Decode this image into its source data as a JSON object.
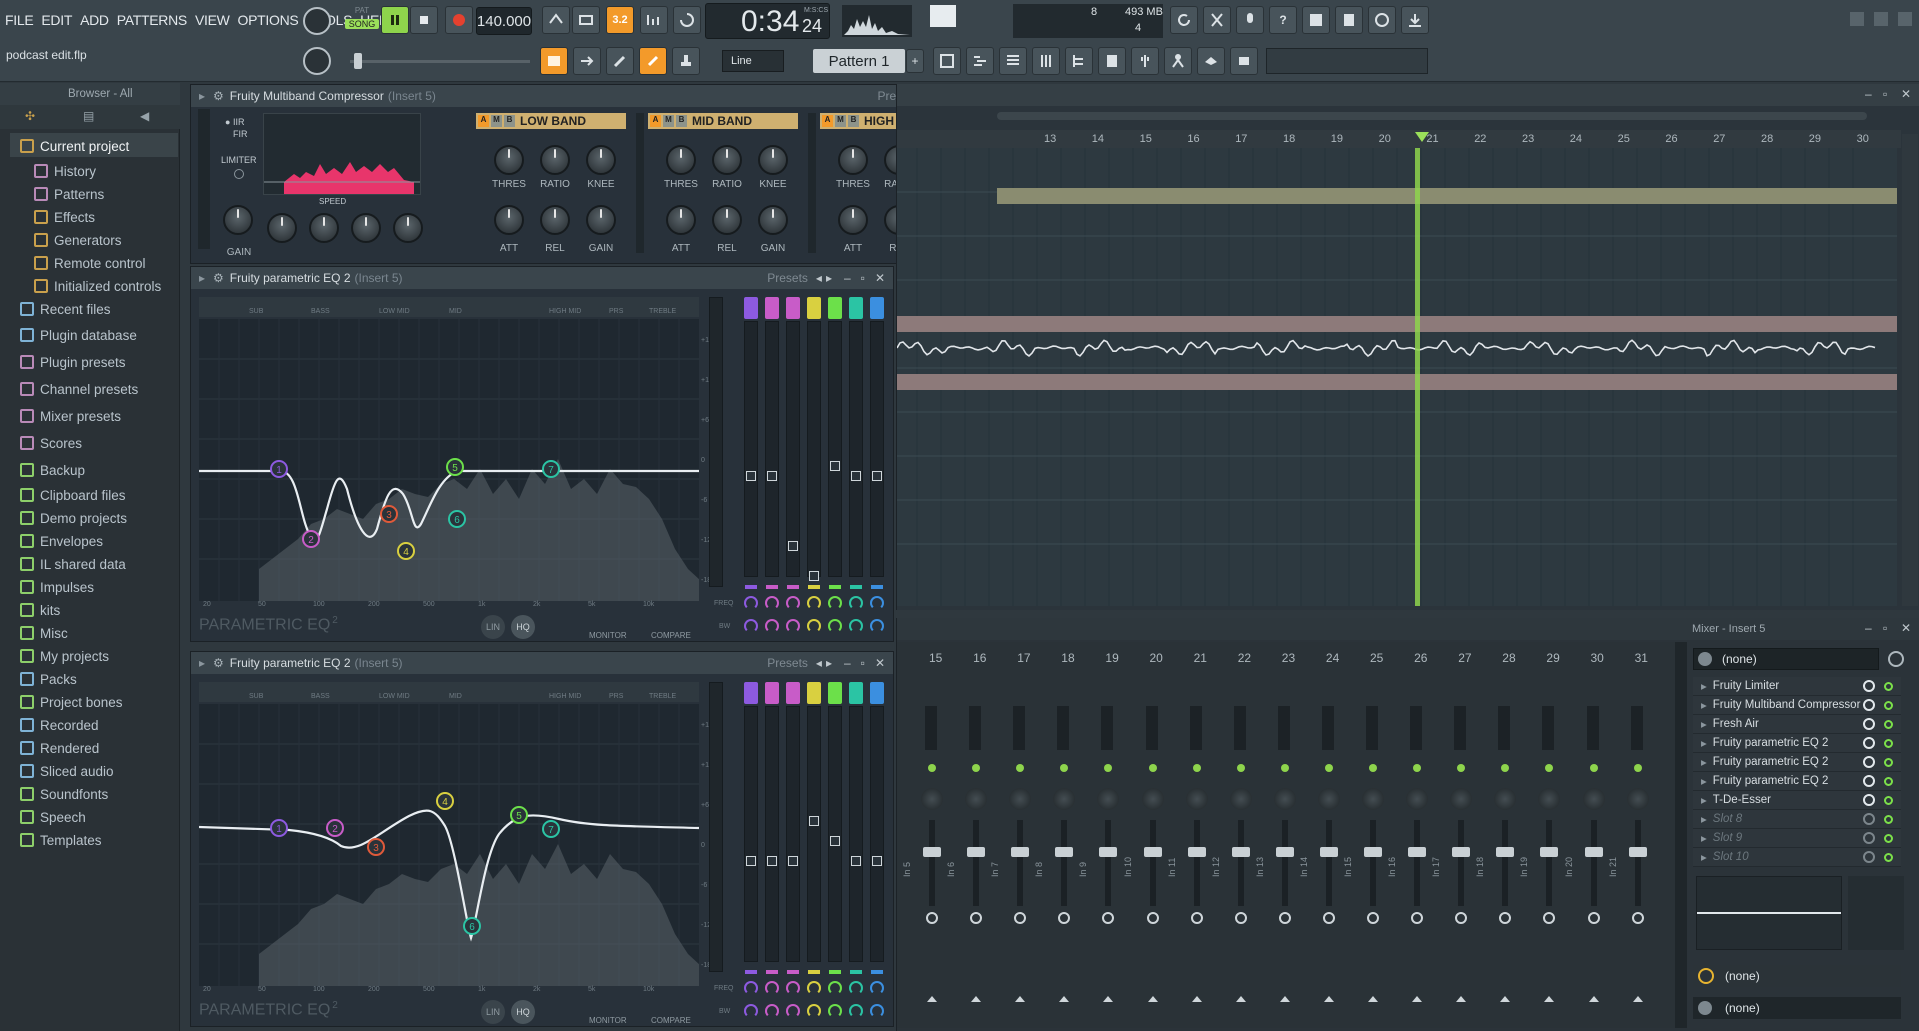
{
  "menu": [
    "FILE",
    "EDIT",
    "ADD",
    "PATTERNS",
    "VIEW",
    "OPTIONS",
    "TOOLS",
    "HELP"
  ],
  "transport": {
    "mode_pat": "PAT",
    "mode_song": "SONG",
    "tempo": "140.000",
    "time": "0:34",
    "time_sub": "24",
    "time_label": "M:S:CS",
    "snap": "3.2"
  },
  "status": {
    "cpu": "8",
    "mem": "493 MB",
    "poly": "4"
  },
  "project_file": "podcast edit.flp",
  "toolbar2": {
    "snap_mode": "Line",
    "pattern": "Pattern 1"
  },
  "browser": {
    "title": "Browser - All",
    "items": [
      "Current project",
      "History",
      "Patterns",
      "Effects",
      "Generators",
      "Remote control",
      "Initialized controls",
      "Recent files",
      "Plugin database",
      "Plugin presets",
      "Channel presets",
      "Mixer presets",
      "Scores",
      "Backup",
      "Clipboard files",
      "Demo projects",
      "Envelopes",
      "IL shared data",
      "Impulses",
      "kits",
      "Misc",
      "My projects",
      "Packs",
      "Project bones",
      "Recorded",
      "Rendered",
      "Sliced audio",
      "Soundfonts",
      "Speech",
      "Templates"
    ]
  },
  "mbc": {
    "title": "Fruity Multiband Compressor",
    "insert": "(Insert 5)",
    "presets": "Presets",
    "iir": "IIR",
    "fir": "FIR",
    "limiter": "LIMITER",
    "gain": "GAIN",
    "speed": "SPEED",
    "bands": [
      "LOW BAND",
      "MID BAND",
      "HIGH BAND"
    ],
    "knobs_top": [
      "THRES",
      "RATIO",
      "KNEE"
    ],
    "knobs_bot": [
      "ATT",
      "REL",
      "GAIN"
    ]
  },
  "eq1": {
    "title": "Fruity parametric EQ 2",
    "insert": "(Insert 5)",
    "presets": "Presets"
  },
  "eq2": {
    "title": "Fruity parametric EQ 2",
    "insert": "(Insert 5)",
    "presets": "Presets"
  },
  "eq_common": {
    "band_labels": [
      "SUB",
      "BASS",
      "LOW MID",
      "MID",
      "HIGH MID",
      "PRS",
      "TREBLE"
    ],
    "logo": "PARAMETRIC EQ",
    "logo2": "2",
    "monitor": "MONITOR",
    "compare": "COMPARE",
    "freq": "FREQ",
    "bw": "BW",
    "lin": "LIN",
    "hq": "HQ",
    "db_ticks": [
      "+18",
      "+12",
      "+6",
      "0",
      "-6",
      "-12",
      "-18"
    ],
    "hz_ticks": [
      "20",
      "50",
      "100",
      "200",
      "500",
      "1k",
      "2k",
      "5k",
      "10k"
    ]
  },
  "playlist": {
    "bar_numbers": [
      "13",
      "14",
      "15",
      "16",
      "17",
      "18",
      "19",
      "20",
      "21",
      "22",
      "23",
      "24",
      "25",
      "26",
      "27",
      "28",
      "29",
      "30"
    ]
  },
  "mixer": {
    "title": "Mixer - Insert 5",
    "track_numbers": [
      "15",
      "16",
      "17",
      "18",
      "19",
      "20",
      "21",
      "22",
      "23",
      "24",
      "25",
      "26",
      "27",
      "28",
      "29",
      "30",
      "31"
    ],
    "track_names": [
      "In 5",
      "In 6",
      "In 7",
      "In 8",
      "In 9",
      "In 10",
      "In 11",
      "In 12",
      "In 13",
      "In 14",
      "In 15",
      "In 16",
      "In 17",
      "In 18",
      "In 19",
      "In 20",
      "In 21"
    ],
    "input": "(none)",
    "slots": [
      "Fruity Limiter",
      "Fruity Multiband Compressor",
      "Fresh Air",
      "Fruity parametric EQ 2",
      "Fruity parametric EQ 2",
      "Fruity parametric EQ 2",
      "T-De-Esser",
      "Slot 8",
      "Slot 9",
      "Slot 10"
    ],
    "output": "(none)",
    "output2": "(none)"
  },
  "colors": {
    "accent": "#f39a2a",
    "band_tag": "#cfb070",
    "playhead": "#8ed44c",
    "eq_curve": "#e9eef2",
    "spectrum": "#e8356b",
    "band_pink": "#c85cc8",
    "band_purple": "#8d5ae0",
    "band_teal": "#2bc4a4",
    "band_green": "#6ce04a",
    "band_blue": "#3b8fe0",
    "band_yellow": "#d9d040"
  }
}
